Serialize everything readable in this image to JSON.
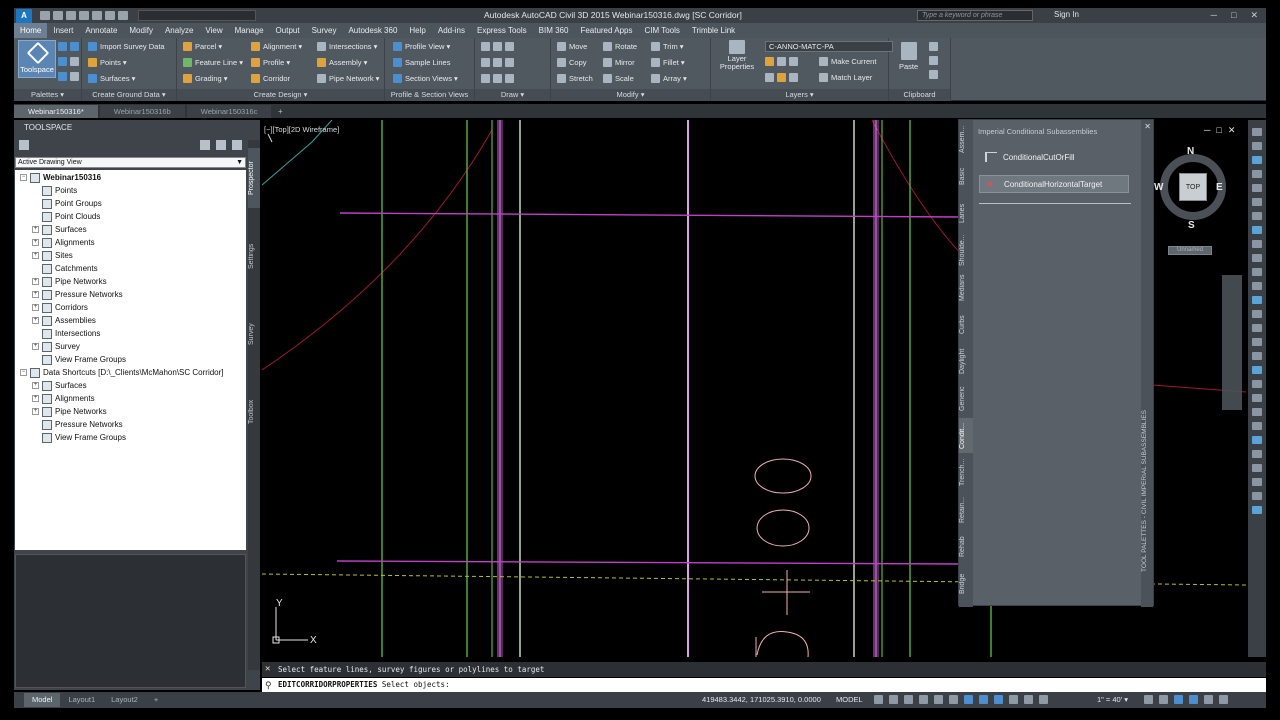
{
  "app": {
    "title": "Autodesk AutoCAD Civil 3D 2015    Webinar150316.dwg [SC Corridor]",
    "logo": "A",
    "search_placeholder": "Type a keyword or phrase",
    "sign_in": "Sign In",
    "window_controls": [
      "─",
      "□",
      "✕"
    ]
  },
  "menu": {
    "items": [
      "Home",
      "Insert",
      "Annotate",
      "Modify",
      "Analyze",
      "View",
      "Manage",
      "Output",
      "Survey",
      "Autodesk 360",
      "Help",
      "Add-ins",
      "Express Tools",
      "BIM 360",
      "Featured Apps",
      "CIM Tools",
      "Trimble Link"
    ],
    "active": "Home"
  },
  "ribbon": {
    "palettes": {
      "title": "Palettes ▾",
      "toolspace": "Toolspace"
    },
    "ground": {
      "title": "Create Ground Data ▾",
      "import_survey": "Import Survey Data",
      "points": "Points ▾",
      "surfaces": "Surfaces ▾"
    },
    "design": {
      "title": "Create Design ▾",
      "parcel": "Parcel ▾",
      "feature_line": "Feature Line ▾",
      "grading": "Grading ▾",
      "alignment": "Alignment ▾",
      "profile": "Profile ▾",
      "corridor": "Corridor",
      "intersections": "Intersections ▾",
      "assembly": "Assembly ▾",
      "pipe_network": "Pipe Network ▾"
    },
    "profile_section": {
      "title": "Profile & Section Views",
      "profile_view": "Profile View ▾",
      "sample_lines": "Sample Lines",
      "section_views": "Section Views ▾"
    },
    "draw": {
      "title": "Draw ▾"
    },
    "modify": {
      "title": "Modify ▾",
      "move": "Move",
      "rotate": "Rotate",
      "trim": "Trim ▾",
      "copy": "Copy",
      "mirror": "Mirror",
      "fillet": "Fillet ▾",
      "stretch": "Stretch",
      "scale": "Scale",
      "array": "Array ▾"
    },
    "layers": {
      "title": "Layers ▾",
      "layer_properties": "Layer Properties",
      "current_layer": "C-ANNO-MATC-PA",
      "make_current": "Make Current",
      "match_layer": "Match Layer"
    },
    "clipboard": {
      "title": "Clipboard",
      "paste": "Paste"
    }
  },
  "doc_tabs": [
    "Webinar150316*",
    "Webinar150316b",
    "Webinar150316c"
  ],
  "doc_tab_add": "+",
  "toolspace": {
    "header": "TOOLSPACE",
    "view_select": "Active Drawing View",
    "tree": [
      {
        "label": "Webinar150316",
        "level": 0,
        "exp": "−",
        "bold": true
      },
      {
        "label": "Points",
        "level": 1,
        "exp": ""
      },
      {
        "label": "Point Groups",
        "level": 1,
        "exp": ""
      },
      {
        "label": "Point Clouds",
        "level": 1,
        "exp": ""
      },
      {
        "label": "Surfaces",
        "level": 1,
        "exp": "+"
      },
      {
        "label": "Alignments",
        "level": 1,
        "exp": "+"
      },
      {
        "label": "Sites",
        "level": 1,
        "exp": "+"
      },
      {
        "label": "Catchments",
        "level": 1,
        "exp": ""
      },
      {
        "label": "Pipe Networks",
        "level": 1,
        "exp": "+"
      },
      {
        "label": "Pressure Networks",
        "level": 1,
        "exp": "+"
      },
      {
        "label": "Corridors",
        "level": 1,
        "exp": "+"
      },
      {
        "label": "Assemblies",
        "level": 1,
        "exp": "+"
      },
      {
        "label": "Intersections",
        "level": 1,
        "exp": ""
      },
      {
        "label": "Survey",
        "level": 1,
        "exp": "+"
      },
      {
        "label": "View Frame Groups",
        "level": 1,
        "exp": ""
      },
      {
        "label": "Data Shortcuts [D:\\_Clients\\McMahon\\SC Corridor]",
        "level": 0,
        "exp": "−"
      },
      {
        "label": "Surfaces",
        "level": 1,
        "exp": "+"
      },
      {
        "label": "Alignments",
        "level": 1,
        "exp": "+"
      },
      {
        "label": "Pipe Networks",
        "level": 1,
        "exp": "+"
      },
      {
        "label": "Pressure Networks",
        "level": 1,
        "exp": ""
      },
      {
        "label": "View Frame Groups",
        "level": 1,
        "exp": ""
      }
    ],
    "vtabs": [
      "Prospector",
      "Settings",
      "Survey",
      "Toolbox"
    ],
    "active_vtab": "Prospector"
  },
  "viewport": {
    "label": "[−][Top][2D Wireframe]",
    "axis_y": "Y",
    "axis_x": "X"
  },
  "palette": {
    "title": "Imperial Conditional Subassemblies",
    "items": [
      {
        "label": "ConditionalCutOrFill",
        "icon": "subassembly-icon",
        "selected": false
      },
      {
        "label": "ConditionalHorizontalTarget",
        "icon": "error-x-icon",
        "selected": true
      }
    ],
    "vtabs": [
      "Assem...",
      "Basic",
      "Lanes",
      "Shoulde...",
      "Medians",
      "Curbs",
      "Daylight",
      "Generic",
      "Condit...",
      "Trench...",
      "Retain...",
      "Rehab",
      "Bridge"
    ],
    "active_vtab": "Condit...",
    "side_title": "TOOL PALETTES - CIVIL IMPERIAL SUBASSEMBLIES"
  },
  "viewcube": {
    "n": "N",
    "s": "S",
    "e": "E",
    "w": "W",
    "top": "TOP",
    "ucs": "Unnamed"
  },
  "command": {
    "history": "Select feature lines, survey figures or polylines to target",
    "prompt_cmd": "EDITCORRIDORPROPERTIES",
    "prompt_text": " Select objects:"
  },
  "status": {
    "tabs": [
      "Model",
      "Layout1",
      "Layout2"
    ],
    "active_tab": "Model",
    "add": "+",
    "coords": "419483.3442, 171025.3910, 0.0000",
    "space": "MODEL",
    "scale": "1\" = 40' ▾"
  },
  "colors": {
    "feature_green": "#5fb040",
    "feature_pink": "#e0a0e8",
    "feature_magenta": "#c040c8",
    "alignment_red": "#a01830",
    "cad_text_pink": "#f0b0b8",
    "lane_yellow": "#b8c020",
    "teal": "#40a0a0"
  }
}
